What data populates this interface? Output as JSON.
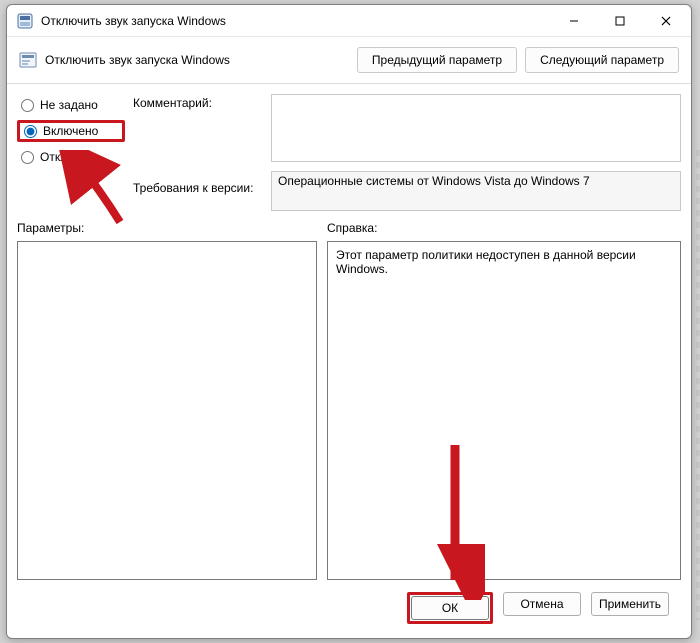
{
  "titlebar": {
    "title": "Отключить звук запуска Windows"
  },
  "subheader": {
    "title": "Отключить звук запуска Windows",
    "prev": "Предыдущий параметр",
    "next": "Следующий параметр"
  },
  "radios": {
    "not_set": "Не задано",
    "enabled": "Включено",
    "disabled": "Отключ"
  },
  "labels": {
    "comment": "Комментарий:",
    "requirements": "Требования к версии:",
    "params": "Параметры:",
    "help": "Справка:"
  },
  "fields": {
    "comment_value": "",
    "requirements_value": "Операционные системы от Windows Vista до Windows 7"
  },
  "help": {
    "text": "Этот параметр политики недоступен в данной версии Windows."
  },
  "footer": {
    "ok": "ОК",
    "cancel": "Отмена",
    "apply": "Применить"
  }
}
